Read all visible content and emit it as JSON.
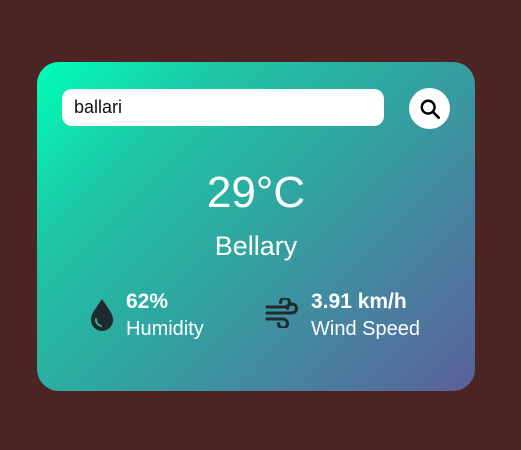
{
  "search": {
    "value": "ballari"
  },
  "weather": {
    "temperature": "29°C",
    "city": "Bellary"
  },
  "humidity": {
    "value": "62%",
    "label": "Humidity",
    "icon": "water-drop-icon"
  },
  "wind": {
    "value": "3.91 km/h",
    "label": "Wind Speed",
    "icon": "wind-icon"
  },
  "search_button": {
    "icon": "search-icon"
  },
  "colors": {
    "page_background": "#4d2424",
    "card_gradient_start": "#00ffb8",
    "card_gradient_end": "#5b5f9a",
    "text": "#ffffff",
    "icon_dark": "#1f2a2e"
  }
}
